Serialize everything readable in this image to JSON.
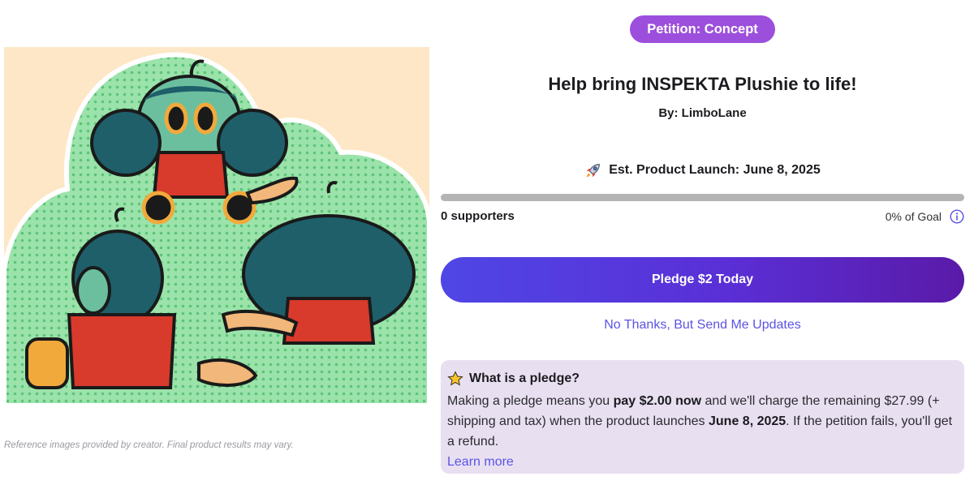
{
  "campaign": {
    "badge": "Petition: Concept",
    "title": "Help bring INSPEKTA Plushie to life!",
    "byline": "By: LimboLane",
    "launch": "Est. Product Launch: June 8, 2025",
    "progress_percent": 0,
    "supporters": "0 supporters",
    "goal": "0% of Goal"
  },
  "actions": {
    "pledge_label": "Pledge $2 Today",
    "updates_label": "No Thanks, But Send Me Updates"
  },
  "pledge_info": {
    "heading": "What is a pledge?",
    "body_1": "Making a pledge means you ",
    "body_bold_1": "pay $2.00 now",
    "body_2": " and we'll charge the remaining $27.99 (+ shipping and tax) when the product launches ",
    "body_bold_2": "June 8, 2025",
    "body_3": ". If the petition fails, you'll get a refund.",
    "learn_more": "Learn more"
  },
  "gallery": {
    "disclaimer": "Reference images provided by creator. Final product results may vary."
  },
  "icons": {
    "launch": "rocket-icon",
    "goal_info": "info-icon",
    "pledge_info": "star-icon"
  },
  "colors": {
    "badge": "#9c4fdc",
    "button_start": "#4f46e6",
    "button_end": "#5a1aa8",
    "link": "#5b53e3",
    "info_box": "#e8e0f1",
    "progress_track": "#b4b4b4"
  }
}
